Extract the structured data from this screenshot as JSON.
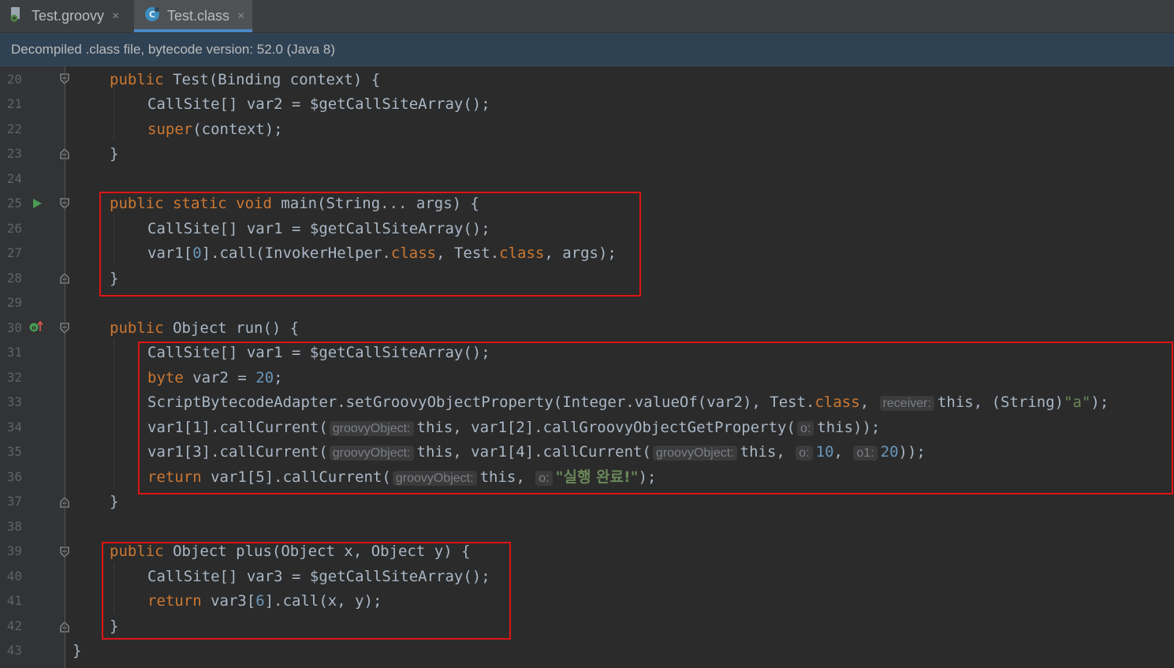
{
  "tabs": [
    {
      "label": "Test.groovy",
      "icon": "groovy-file-icon",
      "close": "×"
    },
    {
      "label": "Test.class",
      "icon": "class-file-icon",
      "close": "×"
    }
  ],
  "banner": {
    "text": "Decompiled .class file, bytecode version: 52.0 (Java 8)"
  },
  "line_numbers": [
    "20",
    "21",
    "22",
    "23",
    "24",
    "25",
    "26",
    "27",
    "28",
    "29",
    "30",
    "31",
    "32",
    "33",
    "34",
    "35",
    "36",
    "37",
    "38",
    "39",
    "40",
    "41",
    "42",
    "43"
  ],
  "code": {
    "l20": {
      "kw": "public ",
      "rest": "Test(Binding context) {"
    },
    "l21": {
      "text": "CallSite[] var2 = $getCallSiteArray();"
    },
    "l22": {
      "kw": "super",
      "rest": "(context);"
    },
    "l23": {
      "text": "}"
    },
    "l25": {
      "kw": "public static void ",
      "rest": "main(String... args) {"
    },
    "l26": {
      "text": "CallSite[] var1 = $getCallSiteArray();"
    },
    "l27": {
      "a": "var1[",
      "n": "0",
      "b": "].call(InvokerHelper.",
      "k1": "class",
      "c": ", Test.",
      "k2": "class",
      "d": ", args);"
    },
    "l28": {
      "text": "}"
    },
    "l30": {
      "kw": "public ",
      "rest": "Object run() {"
    },
    "l31": {
      "text": "CallSite[] var1 = $getCallSiteArray();"
    },
    "l32": {
      "kw": "byte ",
      "rest": "var2 = ",
      "num": "20",
      "end": ";"
    },
    "l33": {
      "a": "ScriptBytecodeAdapter.setGroovyObjectProperty(Integer.valueOf(var2), Test.",
      "k": "class",
      "c": ", ",
      "hint": "receiver:",
      "d": "this, (String)",
      "s": "\"a\"",
      "e": ");"
    },
    "l34": {
      "a": "var1[1].callCurrent(",
      "hint1": "groovyObject:",
      "b": "this, var1[2].callGroovyObjectGetProperty(",
      "hint2": "o:",
      "c": "this));"
    },
    "l35": {
      "a": "var1[3].callCurrent(",
      "hint1": "groovyObject:",
      "b": "this, var1[4].callCurrent(",
      "hint2": "groovyObject:",
      "c": "this, ",
      "hint3": "o:",
      "n1": "10",
      "d": ", ",
      "hint4": "o1:",
      "n2": "20",
      "e": "));"
    },
    "l36": {
      "kw": "return ",
      "a": "var1[5].callCurrent(",
      "hint1": "groovyObject:",
      "b": "this, ",
      "hint2": "o:",
      "s": "\"실행 완료!\"",
      "e": ");"
    },
    "l37": {
      "text": "}"
    },
    "l39": {
      "kw": "public ",
      "rest": "Object plus(Object x, Object y) {"
    },
    "l40": {
      "text": "CallSite[] var3 = $getCallSiteArray();"
    },
    "l41": {
      "kw": "return ",
      "a": "var3[",
      "n": "6",
      "b": "].call(x, y);"
    },
    "l42": {
      "text": "}"
    },
    "l43": {
      "text": "}"
    }
  },
  "colors": {
    "keyword": "#cc7832",
    "number": "#6897bb",
    "string": "#6a8759",
    "text": "#a9b7c6",
    "highlight_box": "#e01414"
  }
}
